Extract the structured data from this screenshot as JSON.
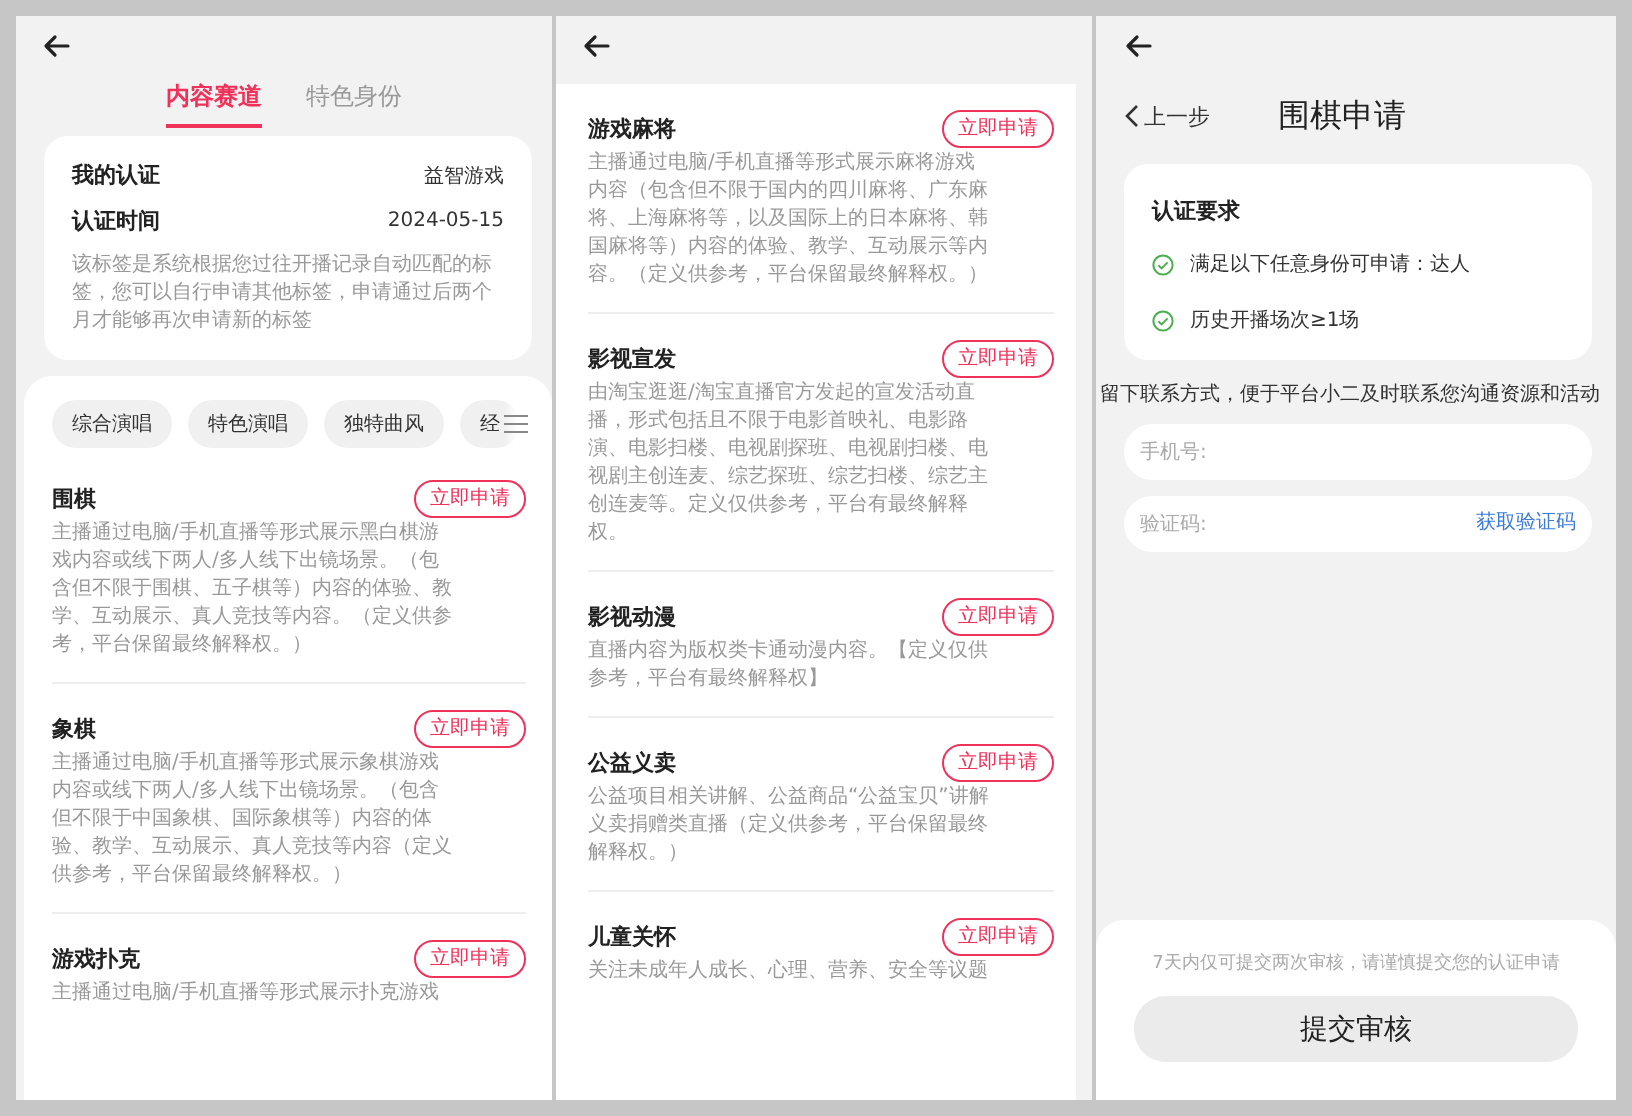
{
  "panels": [
    {
      "kind": "list",
      "tabs": [
        {
          "label": "内容赛道",
          "selected": true
        },
        {
          "label": "特色身份",
          "selected": false
        }
      ],
      "certification": {
        "rows": [
          {
            "label": "我的认证",
            "value": "益智游戏"
          },
          {
            "label": "认证时间",
            "value": "2024-05-15"
          }
        ],
        "note": "该标签是系统根据您过往开播记录自动匹配的标签，您可以自行申请其他标签，申请通过后两个月才能够再次申请新的标签"
      },
      "chips": [
        "综合演唱",
        "特色演唱",
        "独特曲风",
        "经"
      ],
      "items": [
        {
          "title": "围棋",
          "description": "主播通过电脑/手机直播等形式展示黑白棋游戏内容或线下两人/多人线下出镜场景。（包含但不限于围棋、五子棋等）内容的体验、教学、互动展示、真人竞技等内容。（定义供参考，平台保留最终解释权。）",
          "button": "立即申请"
        },
        {
          "title": "象棋",
          "description": "主播通过电脑/手机直播等形式展示象棋游戏内容或线下两人/多人线下出镜场景。（包含但不限于中国象棋、国际象棋等）内容的体验、教学、互动展示、真人竞技等内容（定义供参考，平台保留最终解释权。）",
          "button": "立即申请"
        },
        {
          "title": "游戏扑克",
          "description": "主播通过电脑/手机直播等形式展示扑克游戏",
          "button": "立即申请"
        }
      ]
    },
    {
      "kind": "list",
      "items": [
        {
          "title": "游戏麻将",
          "description": "主播通过电脑/手机直播等形式展示麻将游戏内容（包含但不限于国内的四川麻将、广东麻将、上海麻将等，以及国际上的日本麻将、韩国麻将等）内容的体验、教学、互动展示等内容。（定义供参考，平台保留最终解释权。）",
          "button": "立即申请"
        },
        {
          "title": "影视宣发",
          "description": "由淘宝逛逛/淘宝直播官方发起的宣发活动直播，形式包括且不限于电影首映礼、电影路演、电影扫楼、电视剧探班、电视剧扫楼、电视剧主创连麦、综艺探班、综艺扫楼、综艺主创连麦等。定义仅供参考，平台有最终解释权。",
          "button": "立即申请"
        },
        {
          "title": "影视动漫",
          "description": "直播内容为版权类卡通动漫内容。【定义仅供参考，平台有最终解释权】",
          "button": "立即申请"
        },
        {
          "title": "公益义卖",
          "description": "公益项目相关讲解、公益商品“公益宝贝”讲解义卖捐赠类直播（定义供参考，平台保留最终解释权。）",
          "button": "立即申请"
        },
        {
          "title": "儿童关怀",
          "description": "关注未成年人成长、心理、营养、安全等议题",
          "button": "立即申请"
        }
      ]
    },
    {
      "kind": "form",
      "back_label": "上一步",
      "title": "围棋申请",
      "requirements": {
        "title": "认证要求",
        "items": [
          {
            "text": "满足以下任意身份可申请：达人",
            "checked": true
          },
          {
            "text": "历史开播场次≥1场",
            "checked": true
          }
        ]
      },
      "contact_hint": "留下联系方式，便于平台小二及时联系您沟通资源和活动",
      "fields": [
        {
          "placeholder": "手机号:"
        },
        {
          "placeholder": "验证码:",
          "action": "获取验证码"
        }
      ],
      "footer_note": "7天内仅可提交两次审核，请谨慎提交您的认证申请",
      "submit": "提交审核"
    }
  ]
}
